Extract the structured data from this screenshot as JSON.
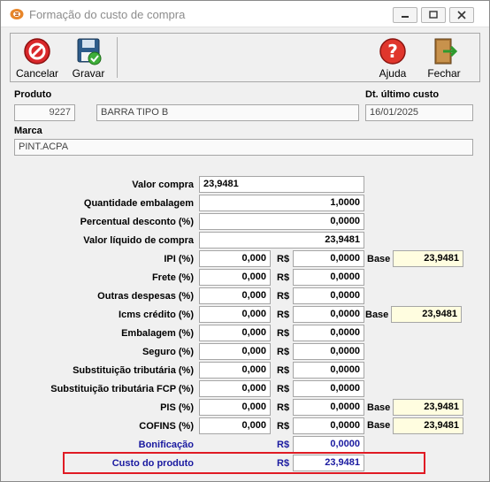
{
  "window": {
    "title": "Formação do custo de compra",
    "controls": {
      "minimize": "minimize",
      "maximize": "maximize",
      "close": "close"
    }
  },
  "toolbar": {
    "cancel_label": "Cancelar",
    "save_label": "Gravar",
    "help_label": "Ajuda",
    "close_label": "Fechar"
  },
  "produto": {
    "label": "Produto",
    "code": "9227",
    "name": "BARRA TIPO B"
  },
  "ultimo_custo": {
    "label": "Dt. último custo",
    "value": "16/01/2025"
  },
  "marca": {
    "label": "Marca",
    "value": "PINT.ACPA"
  },
  "valor_compra": {
    "label": "Valor compra",
    "value": "23,9481"
  },
  "quantidade_embalagem": {
    "label": "Quantidade embalagem",
    "value": "1,0000"
  },
  "percentual_desconto": {
    "label": "Percentual desconto (%)",
    "value": "0,0000"
  },
  "valor_liquido": {
    "label": "Valor líquido de compra",
    "value": "23,9481"
  },
  "currency": "R$",
  "base_label": "Base",
  "rows": [
    {
      "label": "IPI (%)",
      "percent": "0,000",
      "amount": "0,0000",
      "base": "23,9481"
    },
    {
      "label": "Frete (%)",
      "percent": "0,000",
      "amount": "0,0000"
    },
    {
      "label": "Outras despesas (%)",
      "percent": "0,000",
      "amount": "0,0000"
    },
    {
      "label": "Icms crédito (%)",
      "percent": "0,000",
      "amount": "0,0000",
      "base": "23,9481"
    },
    {
      "label": "Embalagem (%)",
      "percent": "0,000",
      "amount": "0,0000"
    },
    {
      "label": "Seguro (%)",
      "percent": "0,000",
      "amount": "0,0000"
    },
    {
      "label": "Substituição tributária (%)",
      "percent": "0,000",
      "amount": "0,0000"
    },
    {
      "label": "Substituição tributária FCP (%)",
      "percent": "0,000",
      "amount": "0,0000"
    },
    {
      "label": "PIS (%)",
      "percent": "0,000",
      "amount": "0,0000",
      "base": "23,9481"
    },
    {
      "label": "COFINS (%)",
      "percent": "0,000",
      "amount": "0,0000",
      "base": "23,9481"
    }
  ],
  "bonificacao": {
    "label": "Bonificação",
    "amount": "0,0000"
  },
  "custo_produto": {
    "label": "Custo do produto",
    "amount": "23,9481"
  },
  "colors": {
    "accent_blue": "#1a1aa0",
    "highlight_red": "#e01b24",
    "base_bg": "#fffde0"
  }
}
